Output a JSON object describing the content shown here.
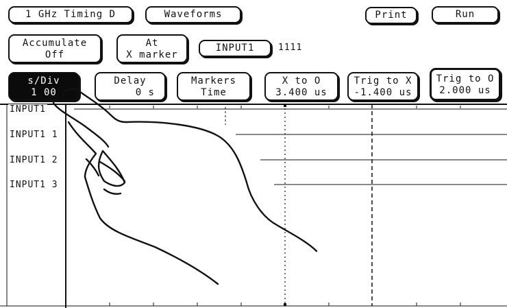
{
  "toolbar": {
    "analyzer_menu": "1 GHz Timing D",
    "display_menu": "Waveforms",
    "print_label": "Print",
    "run_label": "Run"
  },
  "row2": {
    "accumulate": {
      "line1": "Accumulate",
      "line2": "Off"
    },
    "at_marker": {
      "line1": "At",
      "line2": "X marker"
    },
    "label_field": "INPUT1",
    "label_value": "1111"
  },
  "row3": {
    "sdiv": {
      "line1": "s/Div",
      "line2": "1 00"
    },
    "delay": {
      "line1": "Delay",
      "line2": "0  s"
    },
    "markers": {
      "line1": "Markers",
      "line2": "Time"
    },
    "x_to_o": {
      "line1": "X to O",
      "line2": "3.400 us"
    },
    "trig_to_x": {
      "line1": "Trig to X",
      "line2": "-1.400 us"
    },
    "trig_to_o": {
      "line1": "Trig to O",
      "line2": "2.000 us"
    }
  },
  "waveform": {
    "channels": [
      "INPUT1",
      "INPUT1  1",
      "INPUT1  2",
      "INPUT1  3"
    ],
    "markers": [
      "trigger",
      "X",
      "O"
    ]
  }
}
